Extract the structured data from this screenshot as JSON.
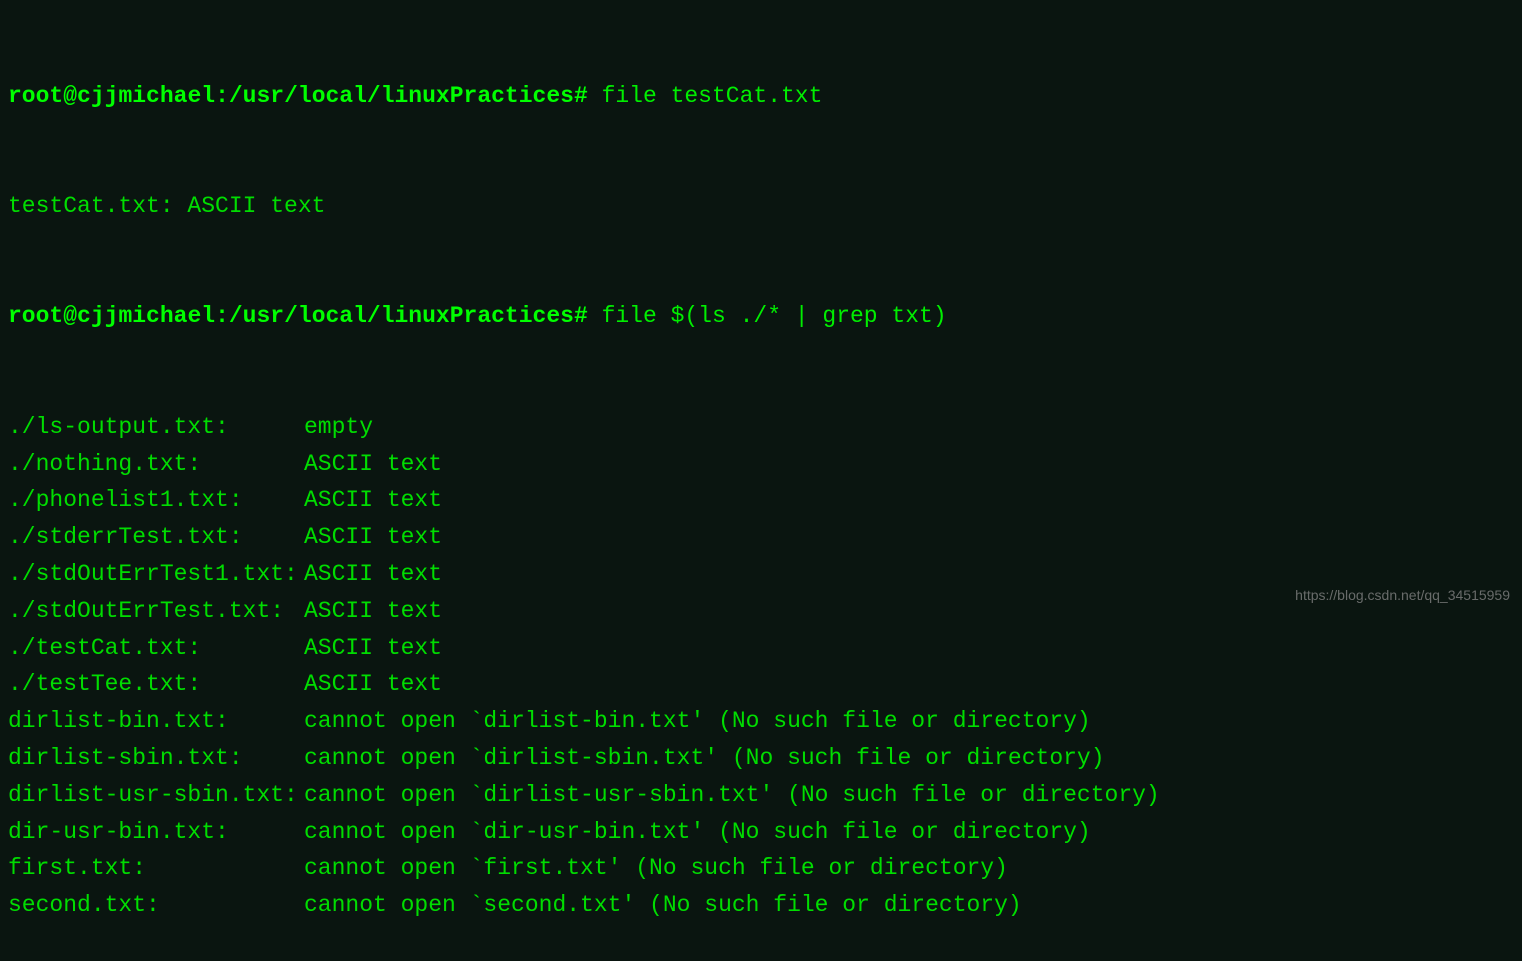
{
  "prompt": {
    "user": "root",
    "host": "cjjmichael",
    "path": "/usr/local/linuxPractices",
    "end": "#"
  },
  "commands": {
    "cmd1": "file testCat.txt",
    "cmd2": "file $(ls ./* | grep txt)"
  },
  "output1": "testCat.txt: ASCII text",
  "file_results": [
    {
      "name": "./ls-output.txt:",
      "desc": "empty"
    },
    {
      "name": "./nothing.txt:",
      "desc": "ASCII text"
    },
    {
      "name": "./phonelist1.txt:",
      "desc": "ASCII text"
    },
    {
      "name": "./stderrTest.txt:",
      "desc": "ASCII text"
    },
    {
      "name": "./stdOutErrTest1.txt:",
      "desc": "ASCII text"
    },
    {
      "name": "./stdOutErrTest.txt:",
      "desc": "ASCII text"
    },
    {
      "name": "./testCat.txt:",
      "desc": "ASCII text"
    },
    {
      "name": "./testTee.txt:",
      "desc": "ASCII text"
    },
    {
      "name": "dirlist-bin.txt:",
      "desc": "cannot open `dirlist-bin.txt' (No such file or directory)"
    },
    {
      "name": "dirlist-sbin.txt:",
      "desc": "cannot open `dirlist-sbin.txt' (No such file or directory)"
    },
    {
      "name": "dirlist-usr-sbin.txt:",
      "desc": "cannot open `dirlist-usr-sbin.txt' (No such file or directory)"
    },
    {
      "name": "dir-usr-bin.txt:",
      "desc": "cannot open `dir-usr-bin.txt' (No such file or directory)"
    },
    {
      "name": "first.txt:",
      "desc": "cannot open `first.txt' (No such file or directory)"
    },
    {
      "name": "second.txt:",
      "desc": "cannot open `second.txt' (No such file or directory)"
    }
  ],
  "watermark": "https://blog.csdn.net/qq_34515959"
}
